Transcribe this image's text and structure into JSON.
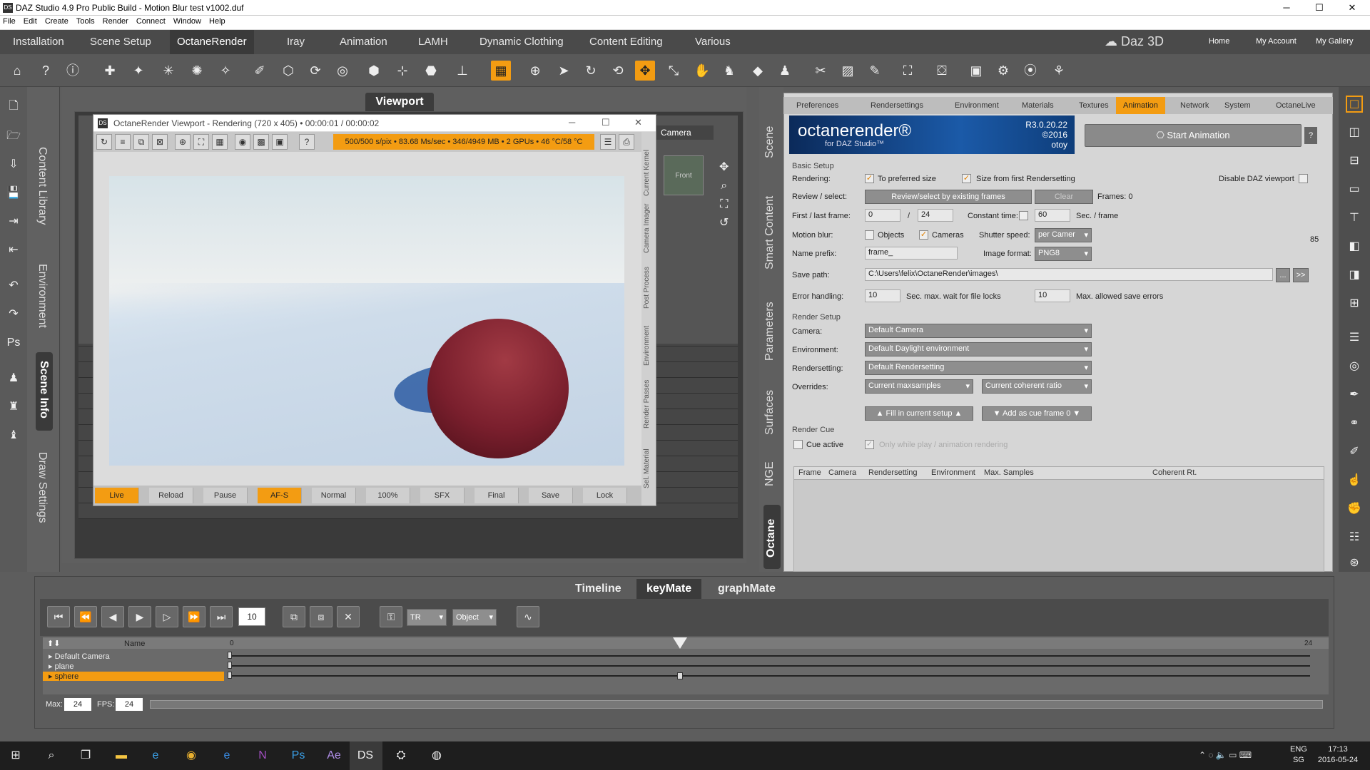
{
  "window": {
    "title": "DAZ Studio 4.9 Pro Public Build - Motion Blur test v1002.duf",
    "minimize": "─",
    "maximize": "☐",
    "close": "✕",
    "app_icon": "DS"
  },
  "menu": [
    "File",
    "Edit",
    "Create",
    "Tools",
    "Render",
    "Connect",
    "Window",
    "Help"
  ],
  "panel_tabs": [
    "Installation",
    "Scene Setup",
    "OctaneRender",
    "Iray",
    "Animation",
    "LAMH",
    "Dynamic Clothing",
    "Content Editing",
    "Various"
  ],
  "active_panel_tab": "OctaneRender",
  "brand": {
    "name": "Daz 3D",
    "links": [
      "Home",
      "My Account",
      "My Gallery"
    ]
  },
  "left_panes": [
    "Content Library",
    "Environment",
    "Scene Info",
    "Draw Settings"
  ],
  "viewport": {
    "title": "Viewport",
    "camera": "Camera"
  },
  "render_window": {
    "title": "OctaneRender Viewport - Rendering (720 x 405) • 00:00:01 / 00:00:02",
    "status": "500/500 s/pix • 83.68 Ms/sec • 346/4949 MB • 2 GPUs • 46 °C/58 °C",
    "buttons": [
      "Live",
      "Reload",
      "Pause",
      "AF-S",
      "Normal",
      "100%",
      "SFX",
      "Final",
      "Save",
      "Lock"
    ],
    "side_tabs": [
      "Current Kernel",
      "Camera Imager",
      "Post Process",
      "Environment",
      "Render Passes",
      "Sel. Material"
    ]
  },
  "right_vertical_tabs": [
    "Scene",
    "Smart Content",
    "Parameters",
    "Surfaces",
    "NGE",
    "Octane"
  ],
  "octane_tabs": [
    "Preferences",
    "Rendersettings",
    "Environment",
    "Materials",
    "Textures",
    "Animation",
    "Network",
    "System",
    "OctaneLive"
  ],
  "active_octane_tab": "Animation",
  "banner": {
    "logo": "octanerender®",
    "sub": "for DAZ Studio™",
    "version_line1": "R3.0.20.22",
    "version_line2": "©2016",
    "maker": "otoy"
  },
  "start_animation": "Start Animation",
  "basic_setup": {
    "section": "Basic Setup",
    "rendering_label": "Rendering:",
    "to_preferred": "To preferred size",
    "size_first": "Size from first Rendersetting",
    "disable_daz": "Disable DAZ viewport",
    "review_label": "Review / select:",
    "review_btn": "Review/select by existing frames",
    "clear_btn": "Clear",
    "frames": "Frames:  0",
    "first_last_label": "First / last frame:",
    "first": "0",
    "slash": "/",
    "last": "24",
    "constant_time": "Constant time:",
    "sec_val": "60",
    "sec_frame": "Sec. / frame",
    "motion_blur": "Motion blur:",
    "objects": "Objects",
    "cameras": "Cameras",
    "shutter_label": "Shutter speed:",
    "shutter": "per Camer",
    "num85": "85",
    "name_prefix_label": "Name prefix:",
    "name_prefix": "frame_",
    "image_format_label": "Image format:",
    "image_format": "PNG8",
    "save_path_label": "Save path:",
    "save_path": "C:\\Users\\felix\\OctaneRender\\images\\",
    "browse": "...",
    "go": ">>",
    "error_label": "Error handling:",
    "err1": "10",
    "err1_txt": "Sec. max. wait for file locks",
    "err2": "10",
    "err2_txt": "Max. allowed save errors"
  },
  "render_setup": {
    "section": "Render Setup",
    "camera_label": "Camera:",
    "camera": "Default Camera",
    "env_label": "Environment:",
    "env": "Default Daylight environment",
    "rs_label": "Rendersetting:",
    "rs": "Default Rendersetting",
    "ov_label": "Overrides:",
    "ov1": "Current maxsamples",
    "ov2": "Current coherent ratio",
    "fill_btn": "▲ Fill in current setup ▲",
    "add_btn": "▼ Add as cue frame 0 ▼"
  },
  "render_cue": {
    "section": "Render Cue",
    "cue_active": "Cue active",
    "only_while": "Only while play / animation rendering",
    "columns": [
      "Frame",
      "Camera",
      "Rendersetting",
      "Environment",
      "Max. Samples",
      "Coherent Rt."
    ]
  },
  "timeline": {
    "tabs": [
      "Timeline",
      "keyMate",
      "graphMate"
    ],
    "active": "keyMate",
    "frame": "10",
    "tr": "TR",
    "object": "Object",
    "name_header": "Name",
    "start": "0",
    "end": "24",
    "tracks": [
      "Default Camera",
      "plane",
      "sphere"
    ],
    "selected_track": "sphere",
    "max_label": "Max:",
    "max": "24",
    "fps_label": "FPS:",
    "fps": "24",
    "current_frame": 10
  },
  "taskbar": {
    "lang": "ENG",
    "region": "SG",
    "time": "17:13",
    "date": "2016-05-24"
  },
  "colors": {
    "accent": "#f39c12",
    "panel": "#5d5d5d"
  }
}
